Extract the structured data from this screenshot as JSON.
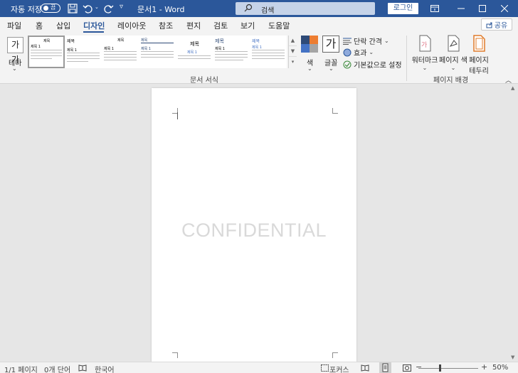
{
  "titlebar": {
    "autosave_label": "자동 저장",
    "autosave_state": "끔",
    "doc_title": "문서1 - Word",
    "search_placeholder": "검색",
    "login_label": "로그인"
  },
  "tabs": [
    {
      "label": "파일"
    },
    {
      "label": "홈"
    },
    {
      "label": "삽입"
    },
    {
      "label": "디자인",
      "active": true
    },
    {
      "label": "레이아웃"
    },
    {
      "label": "참조"
    },
    {
      "label": "편지"
    },
    {
      "label": "검토"
    },
    {
      "label": "보기"
    },
    {
      "label": "도움말"
    }
  ],
  "share_label": "공유",
  "ribbon": {
    "theme_icon_text": "가가",
    "theme_label": "테마",
    "gallery": [
      {
        "heading": "제목",
        "sub": "제목 1"
      },
      {
        "heading": "제목",
        "sub": "제목 1"
      },
      {
        "heading": "제목",
        "sub": "제목 1"
      },
      {
        "heading": "제목",
        "sub": "제목 1"
      },
      {
        "heading": "제목",
        "sub": "제목 1"
      },
      {
        "heading": "제목",
        "sub": "제목 1"
      },
      {
        "heading": "제목",
        "sub": "제목 1"
      }
    ],
    "doc_format_label": "문서 서식",
    "color_label": "색",
    "font_icon_text": "가",
    "font_label": "글꼴",
    "paragraph_spacing_label": "단락 간격",
    "effects_label": "효과",
    "set_default_label": "기본값으로 설정",
    "watermark_label": "워터마크",
    "page_color_label": "페이지 색",
    "page_border_label_1": "페이지",
    "page_border_label_2": "테두리",
    "page_bg_group_label": "페이지 배경",
    "colors": {
      "navy": "#2e4a77",
      "orange": "#ed7d31",
      "blue": "#4472c4",
      "gray": "#a5a5a5"
    }
  },
  "document": {
    "watermark_text": "CONFIDENTIAL"
  },
  "statusbar": {
    "page": "1/1 페이지",
    "words": "0개 단어",
    "language": "한국어",
    "focus": "포커스",
    "zoom": "50%"
  }
}
